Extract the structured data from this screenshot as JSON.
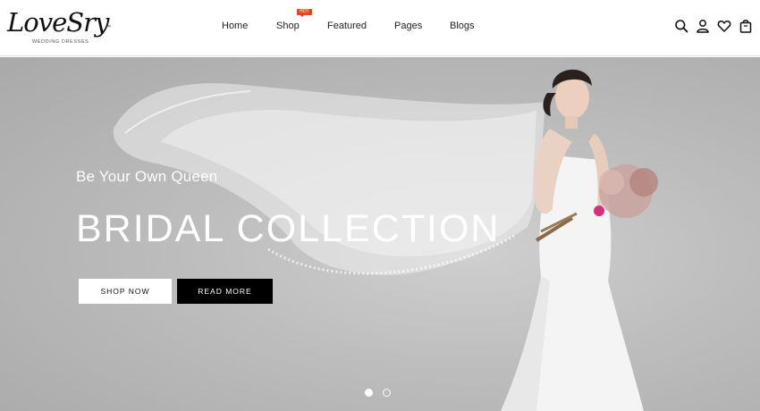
{
  "brand": {
    "logo_script": "LoveSry",
    "logo_tm": "™",
    "logo_tagline": "WEDDING DRESSES"
  },
  "nav": {
    "items": [
      {
        "label": "Home"
      },
      {
        "label": "Shop",
        "badge": "HOT"
      },
      {
        "label": "Featured"
      },
      {
        "label": "Pages"
      },
      {
        "label": "Blogs"
      }
    ]
  },
  "header_icons": [
    "search-icon",
    "user-icon",
    "heart-icon",
    "shopping-bag-icon"
  ],
  "hero": {
    "kicker": "Be Your Own Queen",
    "title": "BRIDAL COLLECTION",
    "primary_button": "SHOP NOW",
    "secondary_button": "READ MORE",
    "slides_total": 2,
    "active_slide": 1
  },
  "colors": {
    "hot_badge": "#e2461f",
    "hero_bg": "#bcbcbc",
    "primary_button_bg": "#ffffff",
    "secondary_button_bg": "#000000"
  }
}
